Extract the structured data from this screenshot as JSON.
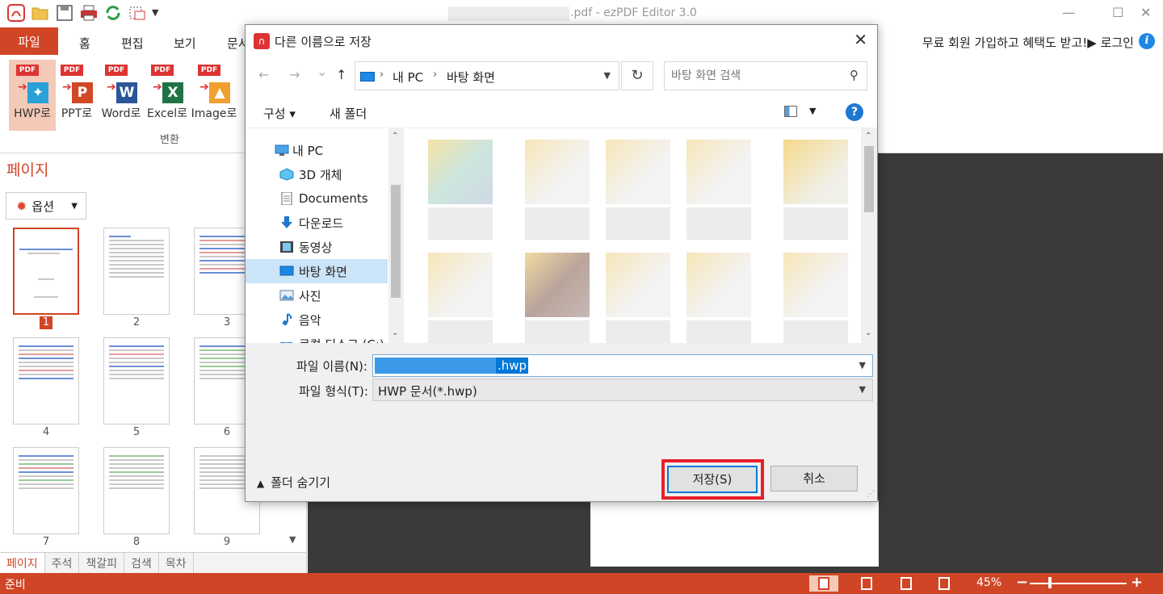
{
  "app": {
    "title": ".pdf - ezPDF Editor 3.0",
    "window_controls": {
      "minimize": "—",
      "maximize": "☐",
      "close": "✕"
    }
  },
  "ribbon": {
    "file_tab": "파일",
    "tabs": [
      "홈",
      "편집",
      "보기",
      "문서"
    ],
    "promo": "무료 회원 가입하고 혜택도 받고!▶ 로그인",
    "convert_buttons": [
      {
        "label": "HWP로",
        "glyph": "✦",
        "color": "#2aa0d8"
      },
      {
        "label": "PPT로",
        "glyph": "P",
        "color": "#d24726"
      },
      {
        "label": "Word로",
        "glyph": "W",
        "color": "#2b579a"
      },
      {
        "label": "Excel로",
        "glyph": "X",
        "color": "#217346"
      },
      {
        "label": "Image로",
        "glyph": "▲",
        "color": "#f0a030"
      }
    ],
    "group_label": "변환"
  },
  "left_panel": {
    "title": "페이지",
    "options_label": "옵션",
    "page_numbers": [
      "1",
      "2",
      "3",
      "4",
      "5",
      "6",
      "7",
      "8",
      "9"
    ],
    "bottom_tabs": [
      "페이지",
      "주석",
      "책갈피",
      "검색",
      "목차"
    ]
  },
  "status": {
    "text": "준비",
    "zoom": "45%",
    "zoom_minus": "−",
    "zoom_plus": "+"
  },
  "dialog": {
    "title": "다른 이름으로 저장",
    "close": "✕",
    "nav": {
      "back": "←",
      "forward": "→",
      "recent": "⌄",
      "up": "↑"
    },
    "address": [
      "내 PC",
      "바탕 화면"
    ],
    "refresh": "↻",
    "search_placeholder": "바탕 화면 검색",
    "commands": {
      "organize": "구성 ▾",
      "new_folder": "새 폴더",
      "help": "?"
    },
    "nav_items": [
      {
        "label": "내 PC",
        "icon": "pc-icon"
      },
      {
        "label": "3D 개체",
        "icon": "cube-icon"
      },
      {
        "label": "Documents",
        "icon": "document-icon"
      },
      {
        "label": "다운로드",
        "icon": "download-icon"
      },
      {
        "label": "동영상",
        "icon": "video-icon"
      },
      {
        "label": "바탕 화면",
        "icon": "desktop-icon"
      },
      {
        "label": "사진",
        "icon": "pictures-icon"
      },
      {
        "label": "음악",
        "icon": "music-icon"
      },
      {
        "label": "로컬 디스크 (C:)",
        "icon": "drive-icon"
      }
    ],
    "selected_nav": "바탕 화면",
    "filename_label": "파일 이름(N):",
    "filename_ext": ".hwp",
    "filetype_label": "파일 형식(T):",
    "filetype_value": "HWP 문서(*.hwp)",
    "hide_folders": "폴더 숨기기",
    "save_label": "저장(S)",
    "cancel_label": "취소",
    "highlight_color": "#e8202a"
  }
}
